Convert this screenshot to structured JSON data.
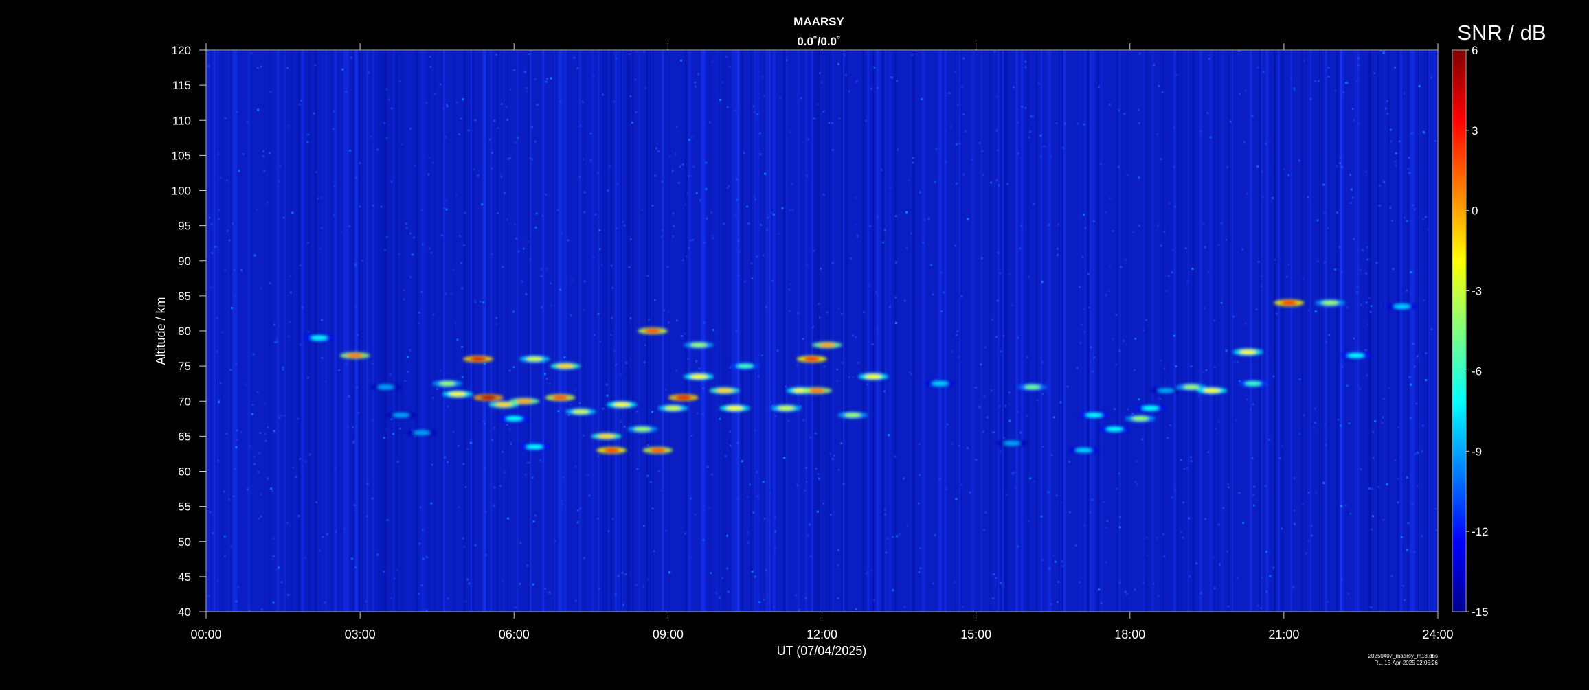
{
  "chart_data": {
    "type": "heatmap",
    "title": "MAARSY",
    "subtitle": "0.0˚/0.0˚",
    "xlabel": "UT (07/04/2025)",
    "ylabel": "Altitude / km",
    "x_ticks": [
      "00:00",
      "03:00",
      "06:00",
      "09:00",
      "12:00",
      "15:00",
      "18:00",
      "21:00",
      "24:00"
    ],
    "xlim_hours": [
      0,
      24
    ],
    "ylim": [
      40,
      120
    ],
    "y_ticks": [
      40,
      45,
      50,
      55,
      60,
      65,
      70,
      75,
      80,
      85,
      90,
      95,
      100,
      105,
      110,
      115,
      120
    ],
    "colorbar": {
      "label": "SNR / dB",
      "range": [
        -15,
        6
      ],
      "ticks": [
        6,
        3,
        0,
        -3,
        -6,
        -9,
        -12,
        -15
      ],
      "colormap": "jet"
    },
    "echo_regions": [
      {
        "t": 2.2,
        "alt": 79,
        "snr": -7
      },
      {
        "t": 2.9,
        "alt": 76.5,
        "snr": 1
      },
      {
        "t": 3.5,
        "alt": 72,
        "snr": -9
      },
      {
        "t": 3.8,
        "alt": 68,
        "snr": -9
      },
      {
        "t": 4.2,
        "alt": 65.5,
        "snr": -9
      },
      {
        "t": 4.7,
        "alt": 72.5,
        "snr": -4
      },
      {
        "t": 4.9,
        "alt": 71,
        "snr": -2
      },
      {
        "t": 5.3,
        "alt": 76,
        "snr": 4
      },
      {
        "t": 5.5,
        "alt": 70.5,
        "snr": 5
      },
      {
        "t": 5.8,
        "alt": 69.5,
        "snr": -1
      },
      {
        "t": 6.0,
        "alt": 67.5,
        "snr": -7
      },
      {
        "t": 6.2,
        "alt": 70,
        "snr": 0
      },
      {
        "t": 6.4,
        "alt": 76,
        "snr": -3
      },
      {
        "t": 6.4,
        "alt": 63.5,
        "snr": -7
      },
      {
        "t": 6.9,
        "alt": 70.5,
        "snr": 2
      },
      {
        "t": 7.0,
        "alt": 75,
        "snr": -1
      },
      {
        "t": 7.3,
        "alt": 68.5,
        "snr": -3
      },
      {
        "t": 7.8,
        "alt": 65,
        "snr": -1
      },
      {
        "t": 7.9,
        "alt": 63,
        "snr": 3
      },
      {
        "t": 8.1,
        "alt": 69.5,
        "snr": -2
      },
      {
        "t": 8.5,
        "alt": 66,
        "snr": -4
      },
      {
        "t": 8.7,
        "alt": 80,
        "snr": 2
      },
      {
        "t": 8.8,
        "alt": 63,
        "snr": 2
      },
      {
        "t": 9.1,
        "alt": 69,
        "snr": -3
      },
      {
        "t": 9.3,
        "alt": 70.5,
        "snr": 4
      },
      {
        "t": 9.6,
        "alt": 73.5,
        "snr": -2
      },
      {
        "t": 9.6,
        "alt": 78,
        "snr": -4
      },
      {
        "t": 10.1,
        "alt": 71.5,
        "snr": -1
      },
      {
        "t": 10.3,
        "alt": 69,
        "snr": -2
      },
      {
        "t": 10.5,
        "alt": 75,
        "snr": -6
      },
      {
        "t": 11.3,
        "alt": 69,
        "snr": -3
      },
      {
        "t": 11.6,
        "alt": 71.5,
        "snr": -2
      },
      {
        "t": 11.8,
        "alt": 76,
        "snr": 3
      },
      {
        "t": 11.9,
        "alt": 71.5,
        "snr": 1
      },
      {
        "t": 12.1,
        "alt": 78,
        "snr": 0
      },
      {
        "t": 12.6,
        "alt": 68,
        "snr": -4
      },
      {
        "t": 13.0,
        "alt": 73.5,
        "snr": -2
      },
      {
        "t": 14.3,
        "alt": 72.5,
        "snr": -8
      },
      {
        "t": 15.7,
        "alt": 64,
        "snr": -9
      },
      {
        "t": 16.1,
        "alt": 72,
        "snr": -5
      },
      {
        "t": 17.1,
        "alt": 63,
        "snr": -8
      },
      {
        "t": 17.3,
        "alt": 68,
        "snr": -7
      },
      {
        "t": 17.7,
        "alt": 66,
        "snr": -7
      },
      {
        "t": 18.2,
        "alt": 67.5,
        "snr": -4
      },
      {
        "t": 18.4,
        "alt": 69,
        "snr": -7
      },
      {
        "t": 18.7,
        "alt": 71.5,
        "snr": -9
      },
      {
        "t": 19.2,
        "alt": 72,
        "snr": -4
      },
      {
        "t": 19.6,
        "alt": 71.5,
        "snr": -2
      },
      {
        "t": 20.4,
        "alt": 72.5,
        "snr": -6
      },
      {
        "t": 20.3,
        "alt": 77,
        "snr": -2
      },
      {
        "t": 21.1,
        "alt": 84,
        "snr": 3
      },
      {
        "t": 21.9,
        "alt": 84,
        "snr": -4
      },
      {
        "t": 22.4,
        "alt": 76.5,
        "snr": -7
      },
      {
        "t": 23.3,
        "alt": 83.5,
        "snr": -8
      }
    ]
  },
  "footer": {
    "file_name": "20250407_maarsy_m18.dbs",
    "created": "RL, 15-Apr-2025 02:05:26"
  }
}
